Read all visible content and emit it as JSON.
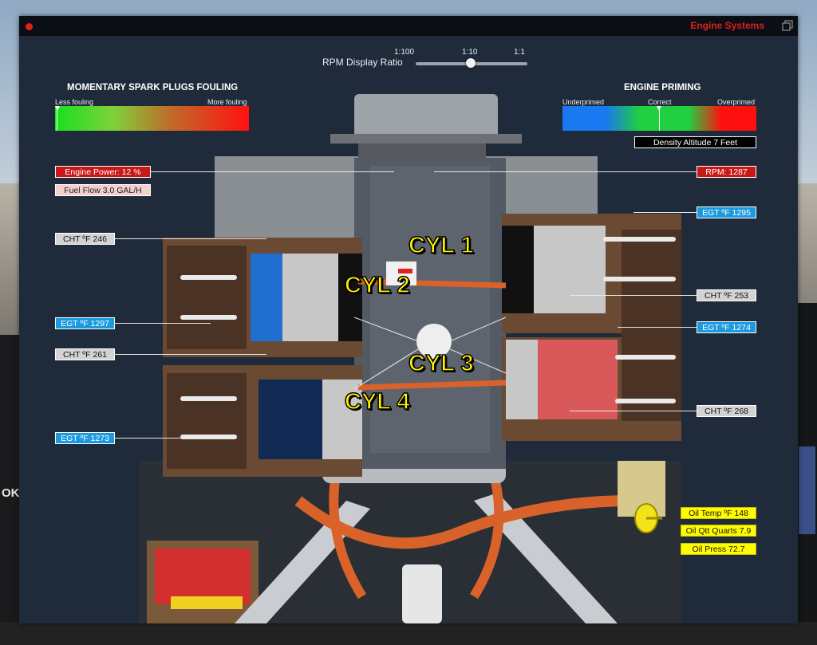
{
  "window": {
    "title": "Engine Systems"
  },
  "rpm_ratio": {
    "label": "RPM Display Ratio",
    "ticks": [
      "1:100",
      "1:10",
      "1:1"
    ],
    "selected": "1:10"
  },
  "spark": {
    "title": "MOMENTARY SPARK PLUGS FOULING",
    "left_label": "Less fouling",
    "right_label": "More fouling",
    "level": 0.0
  },
  "priming": {
    "title": "ENGINE PRIMING",
    "labels": [
      "Underprimed",
      "Correct",
      "Overprimed"
    ],
    "level": 0.5
  },
  "density_altitude": "Density Altitude 7 Feet",
  "left_tags": {
    "engine_power": "Engine Power: 12 %",
    "fuel_flow": "Fuel Flow 3.0 GAL/H",
    "cht_1": "CHT ºF 246",
    "egt_1": "EGT ºF 1297",
    "cht_2": "CHT ºF 261",
    "egt_2": "EGT ºF 1273"
  },
  "right_tags": {
    "rpm": "RPM: 1287",
    "egt_1": "EGT ºF 1295",
    "cht_1": "CHT ºF 253",
    "egt_2": "EGT ºF 1274",
    "cht_2": "CHT ºF 268"
  },
  "oil": {
    "temp": "Oil Temp ºF 148",
    "quantity": "Oil Qtt Quarts 7.9",
    "pressure": "Oil Press 72.7"
  },
  "cylinders": [
    "CYL 1",
    "CYL 2",
    "CYL 3",
    "CYL 4"
  ],
  "background": {
    "status_text": "OK"
  },
  "colors": {
    "accent_red": "#e0201e",
    "egt_blue": "#1c9ae0",
    "oil_yellow": "#fffc00"
  }
}
